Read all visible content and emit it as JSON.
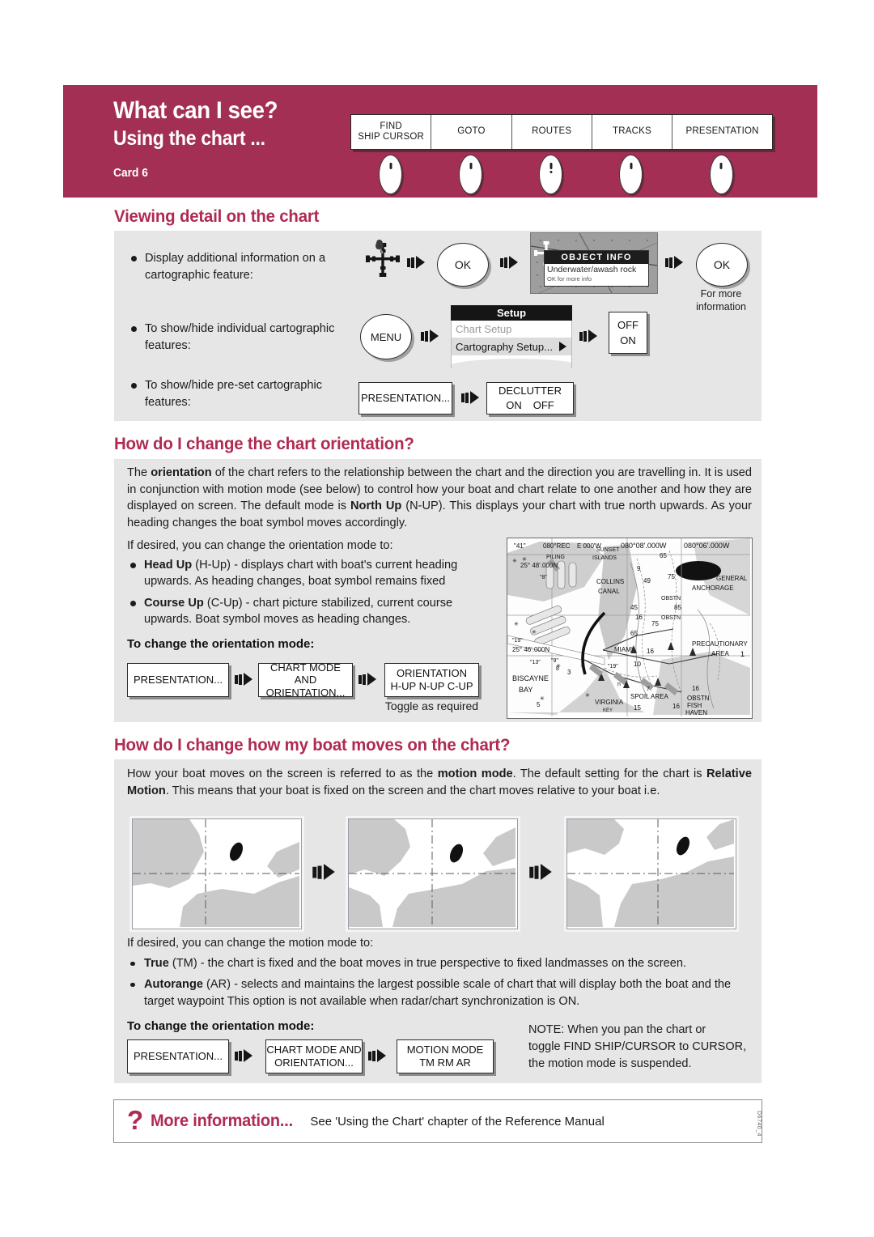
{
  "header": {
    "title": "What can I see?",
    "subtitle": "Using the chart ...",
    "card": "Card 6",
    "accent_color": "#A33054",
    "keys": [
      {
        "line1": "FIND",
        "line2": "SHIP  CURSOR",
        "soft_key": "oval-button"
      },
      {
        "line1": "GOTO",
        "line2": "",
        "soft_key": "oval-button"
      },
      {
        "line1": "ROUTES",
        "line2": "",
        "soft_key": "oval-button-exclaim"
      },
      {
        "line1": "TRACKS",
        "line2": "",
        "soft_key": "oval-button"
      },
      {
        "line1": "PRESENTATION",
        "line2": "",
        "soft_key": "oval-button"
      }
    ]
  },
  "section1": {
    "heading": "Viewing detail on the chart",
    "rows": [
      {
        "text_line1": "Display additional information on a",
        "text_line2": "cartographic feature:",
        "step1_icon": "chart-cursor-icon",
        "button_ok": "OK",
        "screen": {
          "title": "OBJECT INFO",
          "line1": "Underwater/awash rock",
          "line2": "OK for more info"
        },
        "button_ok2": "OK",
        "caption_line1": "For more",
        "caption_line2": "information"
      },
      {
        "text_line1": "To show/hide individual cartographic",
        "text_line2": "features:",
        "button_menu": "MENU",
        "menu": {
          "title": "Setup",
          "item1": "Chart Setup",
          "item2": "Cartography Setup..."
        },
        "toggle_off": "OFF",
        "toggle_on": "ON"
      },
      {
        "text_line1": "To show/hide pre-set cartographic",
        "text_line2": "features:",
        "button_presentation": "PRESENTATION...",
        "declutter_title": "DECLUTTER",
        "declutter_on": "ON",
        "declutter_off": "OFF"
      }
    ]
  },
  "section2": {
    "heading": "How do I change the chart orientation?",
    "paragraph_html": "The <b>orientation</b> of the chart refers to the relationship between the chart and the direction you are travelling in.  It is used in conjunction with motion mode (see below) to control how your boat and chart relate to one another and how they are displayed on screen.  The default mode is <b>North Up</b> (N-UP).  This displays your chart with true north upwards.  As your heading changes the boat symbol moves accordingly.",
    "lead_in": "If desired, you can change the orientation mode to:",
    "bullets_html": [
      "<b>Head Up</b> (H-Up) - displays chart with boat's current heading upwards.  As heading changes, boat symbol remains fixed",
      "<b>Course Up</b> (C-Up) - chart picture stabilized, current course upwards.  Boat symbol moves as heading changes."
    ],
    "procedure_title": "To change the orientation mode:",
    "steps": [
      {
        "line1": "PRESENTATION...",
        "line2": ""
      },
      {
        "line1": "CHART MODE AND",
        "line2": "ORIENTATION..."
      },
      {
        "line1": "ORIENTATION",
        "line2": "H-UP  N-UP  C-UP"
      }
    ],
    "toggle_note": "Toggle as required",
    "chart_image": {
      "type": "nautical-chart-scan",
      "labels": [
        "\"41\"",
        "080°RCTE 000'W",
        "080°08'.000W",
        "080°06'.000W",
        "PILING",
        "SUNSET ISLANDS",
        "65",
        "9",
        "25° 48'.000N",
        "COLLINS CANAL",
        "49",
        "75",
        "GENERAL ANCHORAGE",
        "OBSTN",
        "85",
        "45",
        "16",
        "OBSTN",
        "75",
        "65",
        "25° 46'.000N",
        "MIAMI",
        "16",
        "PRECAUTIONARY AREA",
        "1",
        "BISCAYNE BAY",
        "\"13\"",
        "\"9\"",
        "3",
        "10",
        "VIRGINIA KEY",
        "SPOIL AREA",
        "15",
        "16",
        "OBSTN FISH HAVEN",
        "16",
        "5",
        "7"
      ]
    }
  },
  "section3": {
    "heading": "How do I change how my boat moves on the chart?",
    "paragraph_html": "How your boat moves on the screen is referred to as the <b>motion mode</b>.  The default setting for the chart is <b>Relative Motion</b>.  This means that your boat is fixed on the screen and the chart moves relative to your boat i.e.",
    "panels": [
      {
        "name": "motion-panel-1"
      },
      {
        "name": "motion-panel-2"
      },
      {
        "name": "motion-panel-3"
      }
    ],
    "lead_in": "If desired, you can change the motion mode to:",
    "bullets_html": [
      "<b>True</b> (TM) - the chart is fixed and the boat moves in true perspective to fixed landmasses on the screen.",
      "<b>Autorange</b> (AR) - selects and maintains the largest possible scale of chart that will display both the boat and the target waypoint  This option is not available when radar/chart synchronization is ON."
    ],
    "procedure_title": "To change the orientation mode:",
    "steps": [
      {
        "line1": "PRESENTATION...",
        "line2": ""
      },
      {
        "line1": "CHART MODE AND",
        "line2": "ORIENTATION..."
      },
      {
        "line1": "MOTION MODE",
        "line2": "TM   RM   AR"
      }
    ],
    "note_line1": "NOTE:  When you pan the chart or",
    "note_line2": "toggle FIND SHIP/CURSOR to CURSOR,",
    "note_line3": "the motion mode is suspended."
  },
  "footer": {
    "question_mark": "?",
    "title": "More information...",
    "subtitle": "See 'Using the Chart' chapter of the Reference Manual",
    "doc_id": "D6740_4"
  }
}
